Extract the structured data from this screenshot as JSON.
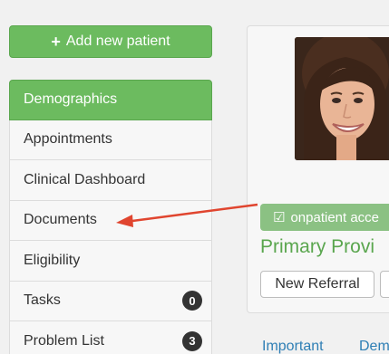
{
  "toolbar": {
    "add_patient_label": "Add new patient"
  },
  "sidebar": {
    "items": [
      {
        "label": "Demographics",
        "active": true
      },
      {
        "label": "Appointments"
      },
      {
        "label": "Clinical Dashboard"
      },
      {
        "label": "Documents"
      },
      {
        "label": "Eligibility"
      },
      {
        "label": "Tasks",
        "badge": "0"
      },
      {
        "label": "Problem List",
        "badge": "3"
      }
    ]
  },
  "patient": {
    "access_label": "onpatient acce",
    "provider_heading": "Primary Provi",
    "new_referral_label": "New Referral"
  },
  "tabs": [
    {
      "label": "Important"
    },
    {
      "label": "Dem"
    }
  ],
  "colors": {
    "accent": "#6cbb5f",
    "link": "#2f7fb5",
    "annotation": "#e0452f"
  }
}
